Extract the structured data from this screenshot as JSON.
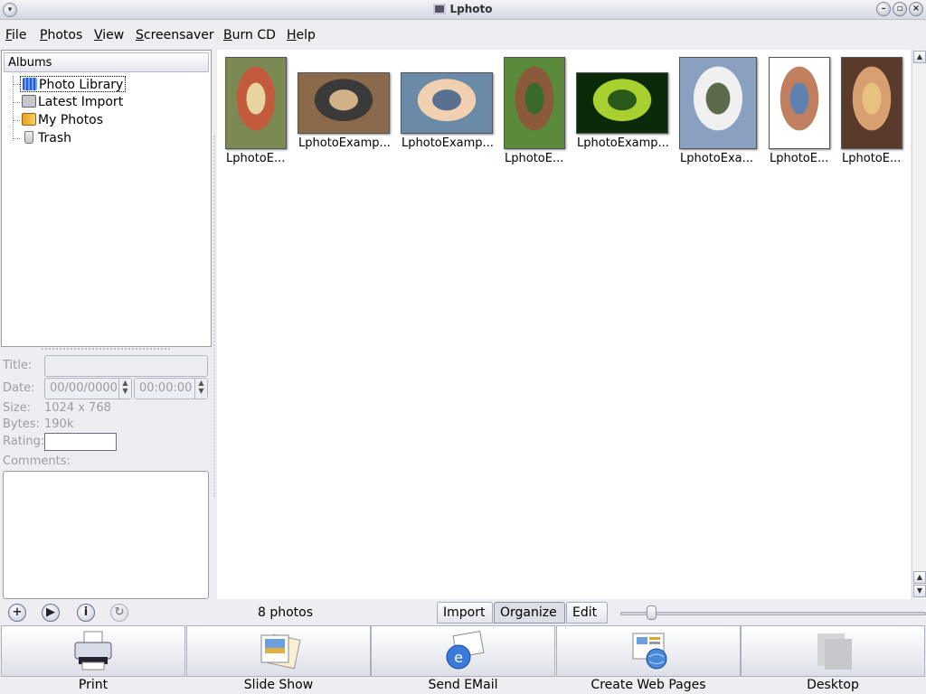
{
  "window": {
    "title": "Lphoto"
  },
  "menu": [
    "File",
    "Photos",
    "View",
    "Screensaver",
    "Burn CD",
    "Help"
  ],
  "albums": {
    "header": "Albums",
    "items": [
      "Photo Library",
      "Latest Import",
      "My Photos",
      "Trash"
    ]
  },
  "props": {
    "title_label": "Title:",
    "date_label": "Date:",
    "date_value": "00/00/0000",
    "time_value": "00:00:00",
    "size_label": "Size:",
    "size_value": "1024 x 768",
    "bytes_label": "Bytes:",
    "bytes_value": "190k",
    "rating_label": "Rating:",
    "comments_label": "Comments:"
  },
  "photos": [
    {
      "caption": "LphotoE...",
      "colors": [
        "#7a8a52",
        "#c25b3d",
        "#e8d4a0"
      ]
    },
    {
      "caption": "LphotoExamp...",
      "colors": [
        "#8a6a4a",
        "#3a3a3a",
        "#d2b088"
      ]
    },
    {
      "caption": "LphotoExamp...",
      "colors": [
        "#6a8aa8",
        "#f0d0b0",
        "#5a7090"
      ]
    },
    {
      "caption": "LphotoE...",
      "colors": [
        "#5a8a3a",
        "#8a5a3a",
        "#3a6a2a"
      ]
    },
    {
      "caption": "LphotoExamp...",
      "colors": [
        "#0a2a0a",
        "#a8d030",
        "#2a5a1a"
      ]
    },
    {
      "caption": "LphotoExa...",
      "colors": [
        "#8aa0c0",
        "#f0f0f0",
        "#5a6a4a"
      ]
    },
    {
      "caption": "LphotoE...",
      "colors": [
        "#ffffff",
        "#c08060",
        "#6080b0"
      ]
    },
    {
      "caption": "LphotoE...",
      "colors": [
        "#5a3a2a",
        "#d8a070",
        "#e8c080"
      ]
    }
  ],
  "status": {
    "count": "8 photos"
  },
  "modes": [
    "Import",
    "Organize",
    "Edit"
  ],
  "active_mode": "Organize",
  "actions": [
    "Print",
    "Slide Show",
    "Send EMail",
    "Create Web Pages",
    "Desktop"
  ]
}
